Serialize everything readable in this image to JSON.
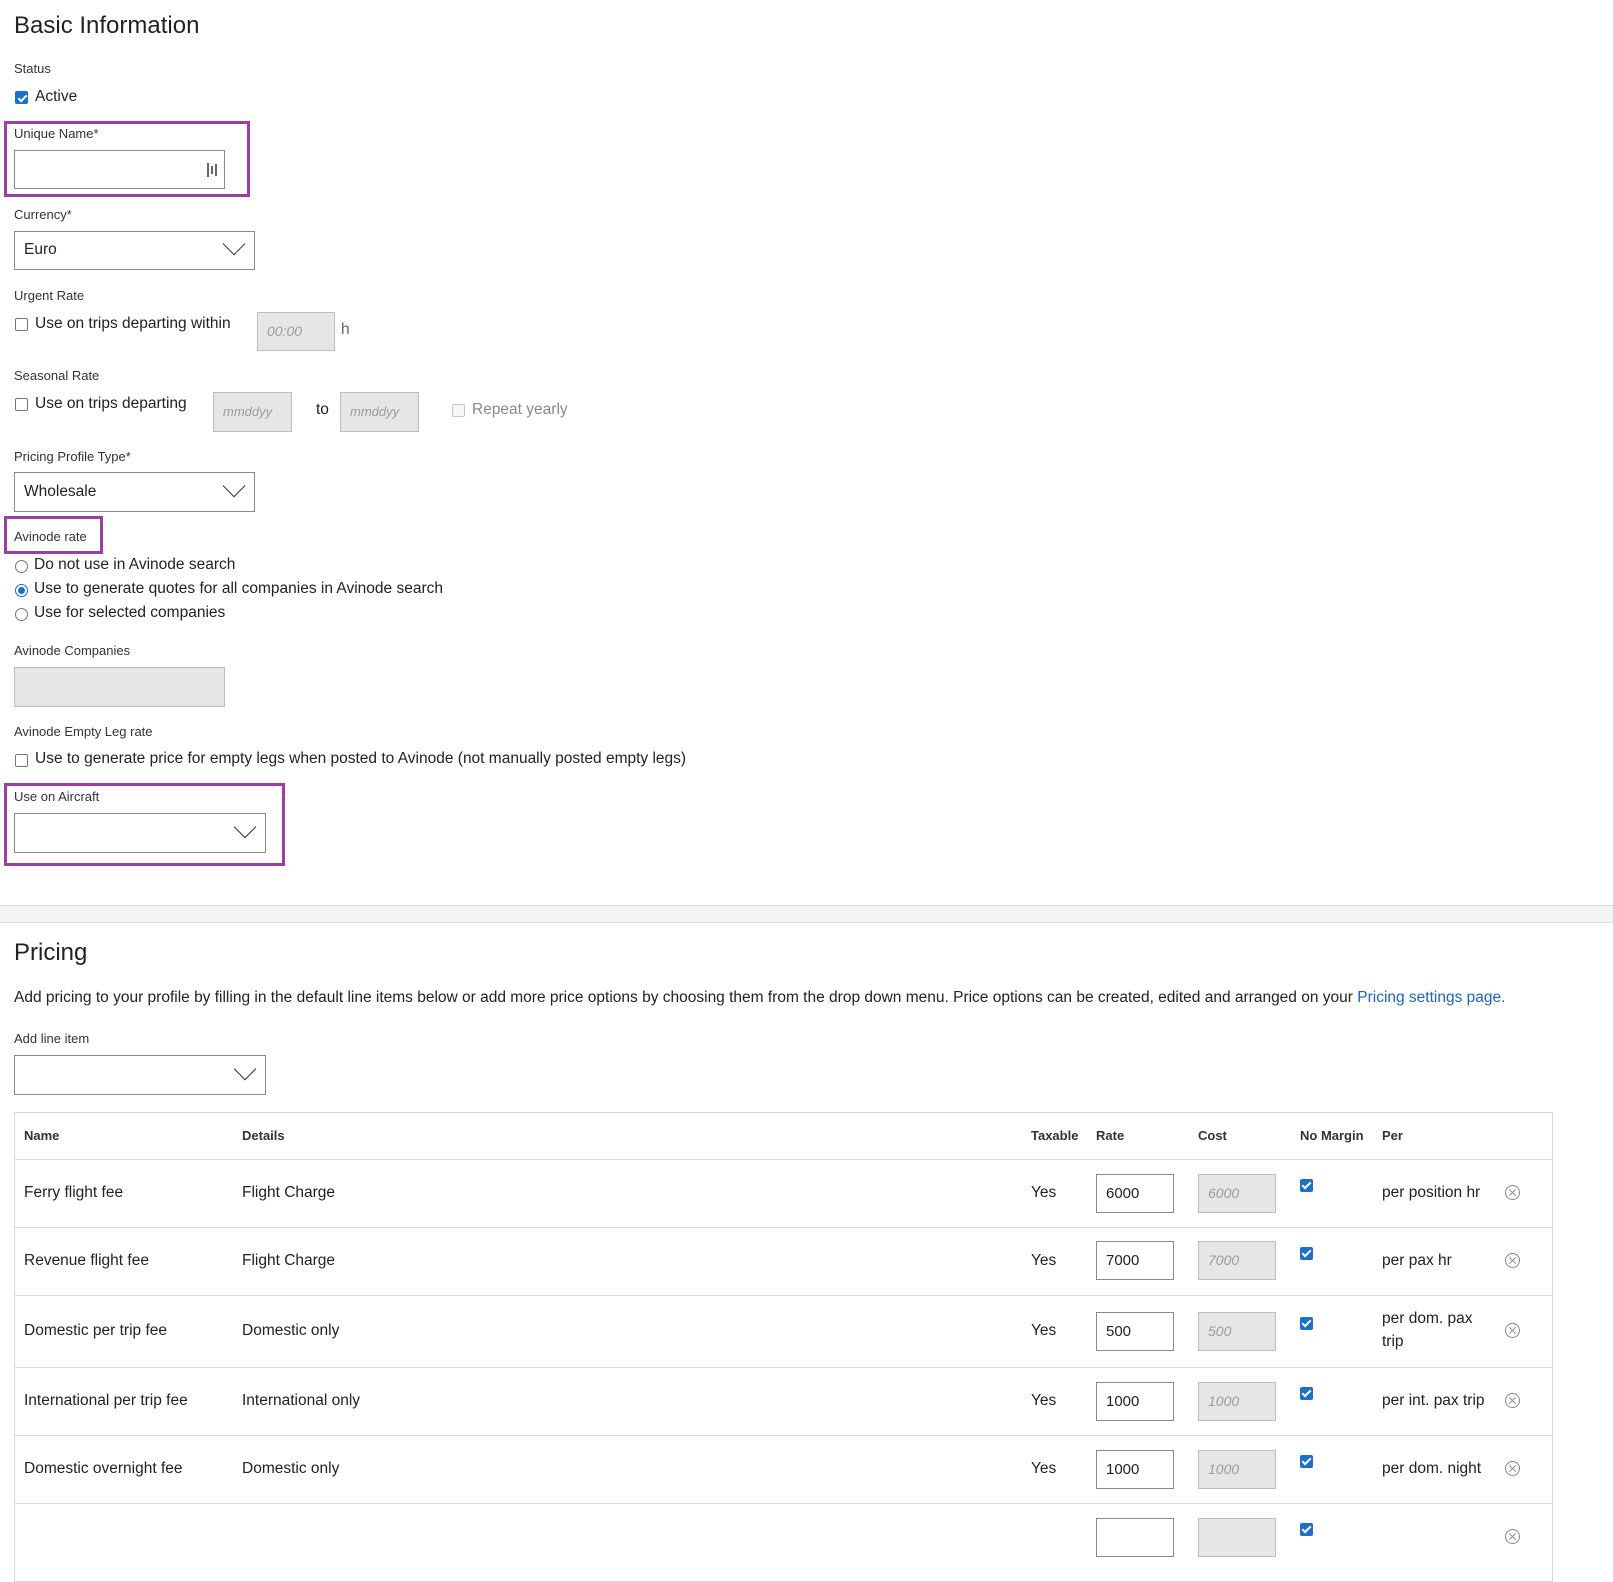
{
  "basic": {
    "title": "Basic Information",
    "status_label": "Status",
    "active_label": "Active",
    "unique_name_label": "Unique Name*",
    "unique_name_value": "",
    "currency_label": "Currency*",
    "currency_value": "Euro",
    "urgent_label": "Urgent Rate",
    "urgent_checkbox_label": "Use on trips departing within",
    "urgent_time_placeholder": "00:00",
    "urgent_unit": "h",
    "seasonal_label": "Seasonal Rate",
    "seasonal_checkbox_label": "Use on trips departing",
    "seasonal_from_placeholder": "mmddyy",
    "seasonal_to_label": "to",
    "seasonal_to_placeholder": "mmddyy",
    "repeat_yearly_label": "Repeat yearly",
    "pricing_type_label": "Pricing Profile Type*",
    "pricing_type_value": "Wholesale",
    "avinode_rate_label": "Avinode rate",
    "avinode_options": [
      "Do not use in Avinode search",
      "Use to generate quotes for all companies in Avinode search",
      "Use for selected companies"
    ],
    "avinode_companies_label": "Avinode Companies",
    "empty_leg_label": "Avinode Empty Leg rate",
    "empty_leg_checkbox_label": "Use to generate price for empty legs when posted to Avinode (not manually posted empty legs)",
    "use_on_aircraft_label": "Use on Aircraft",
    "use_on_aircraft_value": ""
  },
  "pricing": {
    "title": "Pricing",
    "description": "Add pricing to your profile by filling in the default line items below or add more price options by choosing them from the drop down menu. Price options can be created, edited and arranged on your",
    "link_text": "Pricing settings page",
    "description_end": ".",
    "add_line_label": "Add line item",
    "add_line_value": "",
    "columns": [
      "Name",
      "Details",
      "Taxable",
      "Rate",
      "Cost",
      "No Margin",
      "Per"
    ],
    "rows": [
      {
        "name": "Ferry flight fee",
        "details": "Flight Charge",
        "taxable": "Yes",
        "rate": "6000",
        "cost": "6000",
        "per": "per position hr"
      },
      {
        "name": "Revenue flight fee",
        "details": "Flight Charge",
        "taxable": "Yes",
        "rate": "7000",
        "cost": "7000",
        "per": "per pax hr"
      },
      {
        "name": "Domestic per trip fee",
        "details": "Domestic only",
        "taxable": "Yes",
        "rate": "500",
        "cost": "500",
        "per_line1": "per dom. pax",
        "per_line2": "trip"
      },
      {
        "name": "International per trip fee",
        "details": "International only",
        "taxable": "Yes",
        "rate": "1000",
        "cost": "1000",
        "per": "per int. pax trip"
      },
      {
        "name": "Domestic overnight fee",
        "details": "Domestic only",
        "taxable": "Yes",
        "rate": "1000",
        "cost": "1000",
        "per": "per dom. night"
      }
    ]
  },
  "colors": {
    "highlight": "#9b3fa5",
    "accent": "#1a6fd1",
    "link": "#1f63c4"
  }
}
